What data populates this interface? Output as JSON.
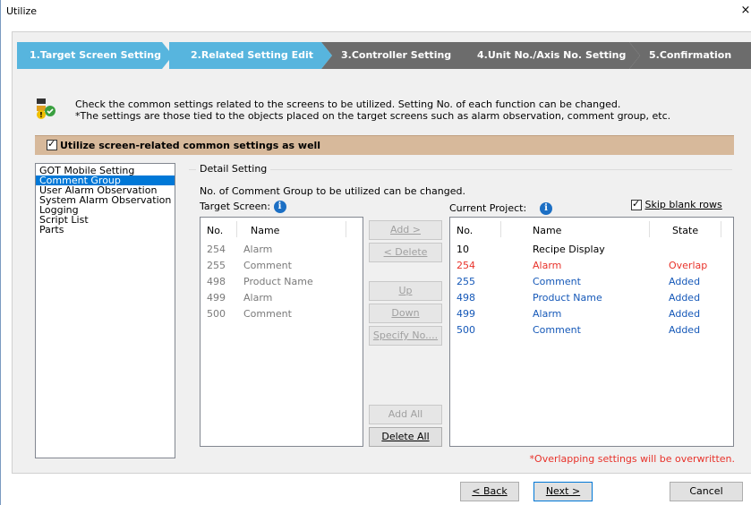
{
  "window": {
    "title": "Utilize",
    "close": "×"
  },
  "steps": [
    {
      "label": "1.Target Screen Setting",
      "active": true
    },
    {
      "label": "2.Related Setting Edit",
      "active": true
    },
    {
      "label": "3.Controller Setting",
      "active": false
    },
    {
      "label": "4.Unit No./Axis No. Setting",
      "active": false
    },
    {
      "label": "5.Confirmation",
      "active": false
    }
  ],
  "info": {
    "line1": "Check the common settings related to the screens to be utilized. Setting No. of each function can be changed.",
    "line2": "*The settings are those tied to the objects placed on the target screens such as alarm observation, comment group, etc."
  },
  "utilize_checkbox": {
    "label": "Utilize screen-related common settings as well",
    "checked": true
  },
  "categories": [
    {
      "label": "GOT Mobile Setting",
      "selected": false
    },
    {
      "label": "Comment Group",
      "selected": true
    },
    {
      "label": "User Alarm Observation",
      "selected": false
    },
    {
      "label": "System Alarm Observation",
      "selected": false
    },
    {
      "label": "Logging",
      "selected": false
    },
    {
      "label": "Script List",
      "selected": false
    },
    {
      "label": "Parts",
      "selected": false
    }
  ],
  "detail": {
    "group_title": "Detail Setting",
    "description": "No. of Comment Group to be utilized can be changed.",
    "target_label": "Target Screen:",
    "current_label": "Current Project:",
    "skip_blank": {
      "label": "Skip blank rows",
      "checked": true
    },
    "info_icon": "i"
  },
  "target_table": {
    "headers": [
      "No.",
      "Name"
    ],
    "rows": [
      {
        "no": "254",
        "name": "Alarm"
      },
      {
        "no": "255",
        "name": "Comment"
      },
      {
        "no": "498",
        "name": "Product Name"
      },
      {
        "no": "499",
        "name": "Alarm"
      },
      {
        "no": "500",
        "name": "Comment"
      }
    ]
  },
  "current_table": {
    "headers": [
      "No.",
      "Name",
      "State"
    ],
    "rows": [
      {
        "no": "10",
        "name": "Recipe Display",
        "state": "",
        "color": "#000000"
      },
      {
        "no": "254",
        "name": "Alarm",
        "state": "Overlap",
        "color": "#e8322a"
      },
      {
        "no": "255",
        "name": "Comment",
        "state": "Added",
        "color": "#1558b8"
      },
      {
        "no": "498",
        "name": "Product Name",
        "state": "Added",
        "color": "#1558b8"
      },
      {
        "no": "499",
        "name": "Alarm",
        "state": "Added",
        "color": "#1558b8"
      },
      {
        "no": "500",
        "name": "Comment",
        "state": "Added",
        "color": "#1558b8"
      }
    ]
  },
  "mid_buttons": {
    "add": "Add >",
    "delete": "< Delete",
    "up": "Up",
    "down": "Down",
    "specify": "Specify No....",
    "add_all": "Add All",
    "delete_all": "Delete All"
  },
  "note": "*Overlapping settings will be overwritten.",
  "footer": {
    "back": "< Back",
    "next": "Next >",
    "cancel": "Cancel"
  },
  "colors": {
    "accent": "#57b5de",
    "inactive_step": "#6c6c6c",
    "bar": "#d7b99b",
    "overlap": "#e8322a",
    "added": "#1558b8",
    "selection": "#0078d7"
  }
}
